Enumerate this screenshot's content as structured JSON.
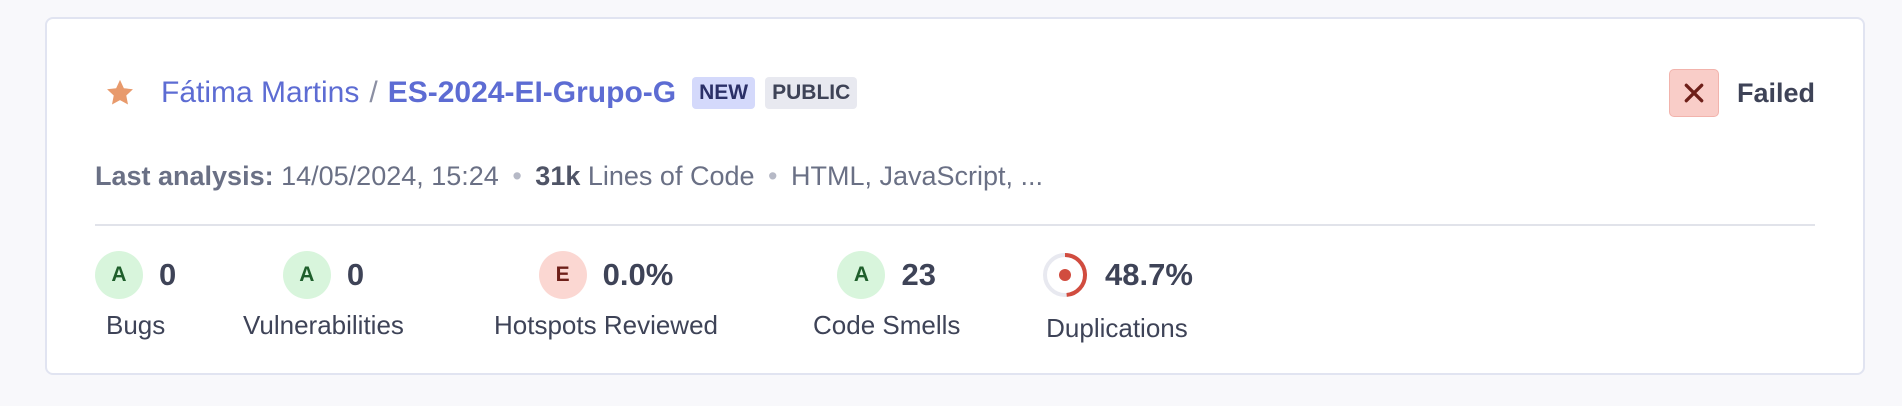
{
  "project": {
    "owner": "Fátima Martins",
    "separator": "/",
    "name": "ES-2024-EI-Grupo-G",
    "badges": [
      "NEW",
      "PUBLIC"
    ],
    "favorite_color": "#e89a6c"
  },
  "quality_gate": {
    "status": "Failed",
    "status_color": "#f9cdc8"
  },
  "meta": {
    "last_analysis_label": "Last analysis:",
    "last_analysis_value": "14/05/2024, 15:24",
    "separator": "•",
    "loc_value": "31k",
    "loc_label": "Lines of Code",
    "languages": "HTML, JavaScript, ..."
  },
  "measures": [
    {
      "rating": "A",
      "value": "0",
      "label": "Bugs"
    },
    {
      "rating": "A",
      "value": "0",
      "label": "Vulnerabilities"
    },
    {
      "rating": "E",
      "value": "0.0%",
      "label": "Hotspots Reviewed"
    },
    {
      "rating": "A",
      "value": "23",
      "label": "Code Smells"
    },
    {
      "icon": "duplications-donut-icon",
      "value": "48.7%",
      "fraction": 0.487,
      "label": "Duplications"
    }
  ],
  "colors": {
    "link": "#5d6cd3",
    "rating_a_bg": "#d8f5dc",
    "rating_e_bg": "#fbd7d2",
    "danger": "#d14c3f"
  }
}
